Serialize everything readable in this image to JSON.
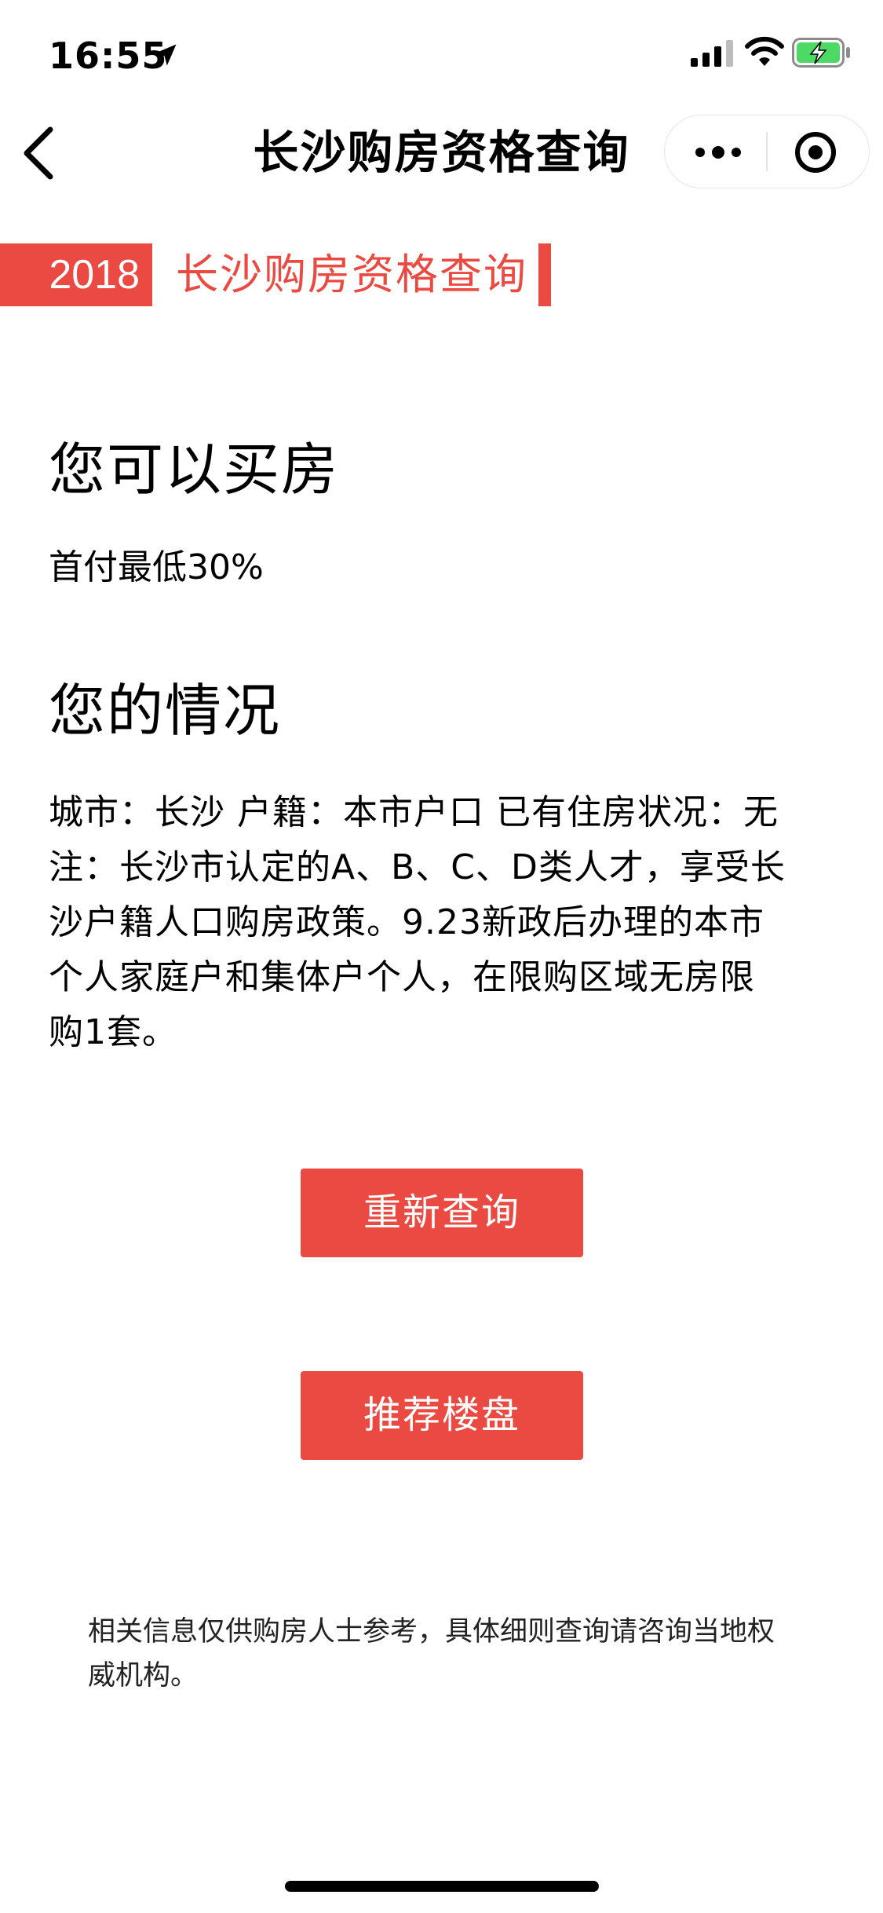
{
  "status_bar": {
    "time": "16:55"
  },
  "nav": {
    "title": "长沙购房资格查询"
  },
  "banner": {
    "year": "2018",
    "title": "长沙购房资格查询"
  },
  "result": {
    "heading": "您可以买房",
    "subtext": "首付最低30%"
  },
  "situation": {
    "heading": "您的情况",
    "body": "城市：长沙 户籍：本市户口 已有住房状况：无\n注：长沙市认定的A、B、C、D类人才，享受长\n沙户籍人口购房政策。9.23新政后办理的本市\n个人家庭户和集体户个人，在限购区域无房限\n购1套。"
  },
  "buttons": {
    "requery": "重新查询",
    "recommend": "推荐楼盘"
  },
  "footer": {
    "disclaimer": "相关信息仅供购房人士参考，具体细则查询请咨询当地权\n威机构。"
  },
  "colors": {
    "accent": "#ea4a42"
  },
  "icons": {
    "location": "location-arrow-icon",
    "signal": "cellular-signal-icon",
    "wifi": "wifi-icon",
    "battery": "battery-charging-icon",
    "back": "chevron-left-icon",
    "more": "more-dots-icon",
    "close": "target-circle-icon"
  }
}
